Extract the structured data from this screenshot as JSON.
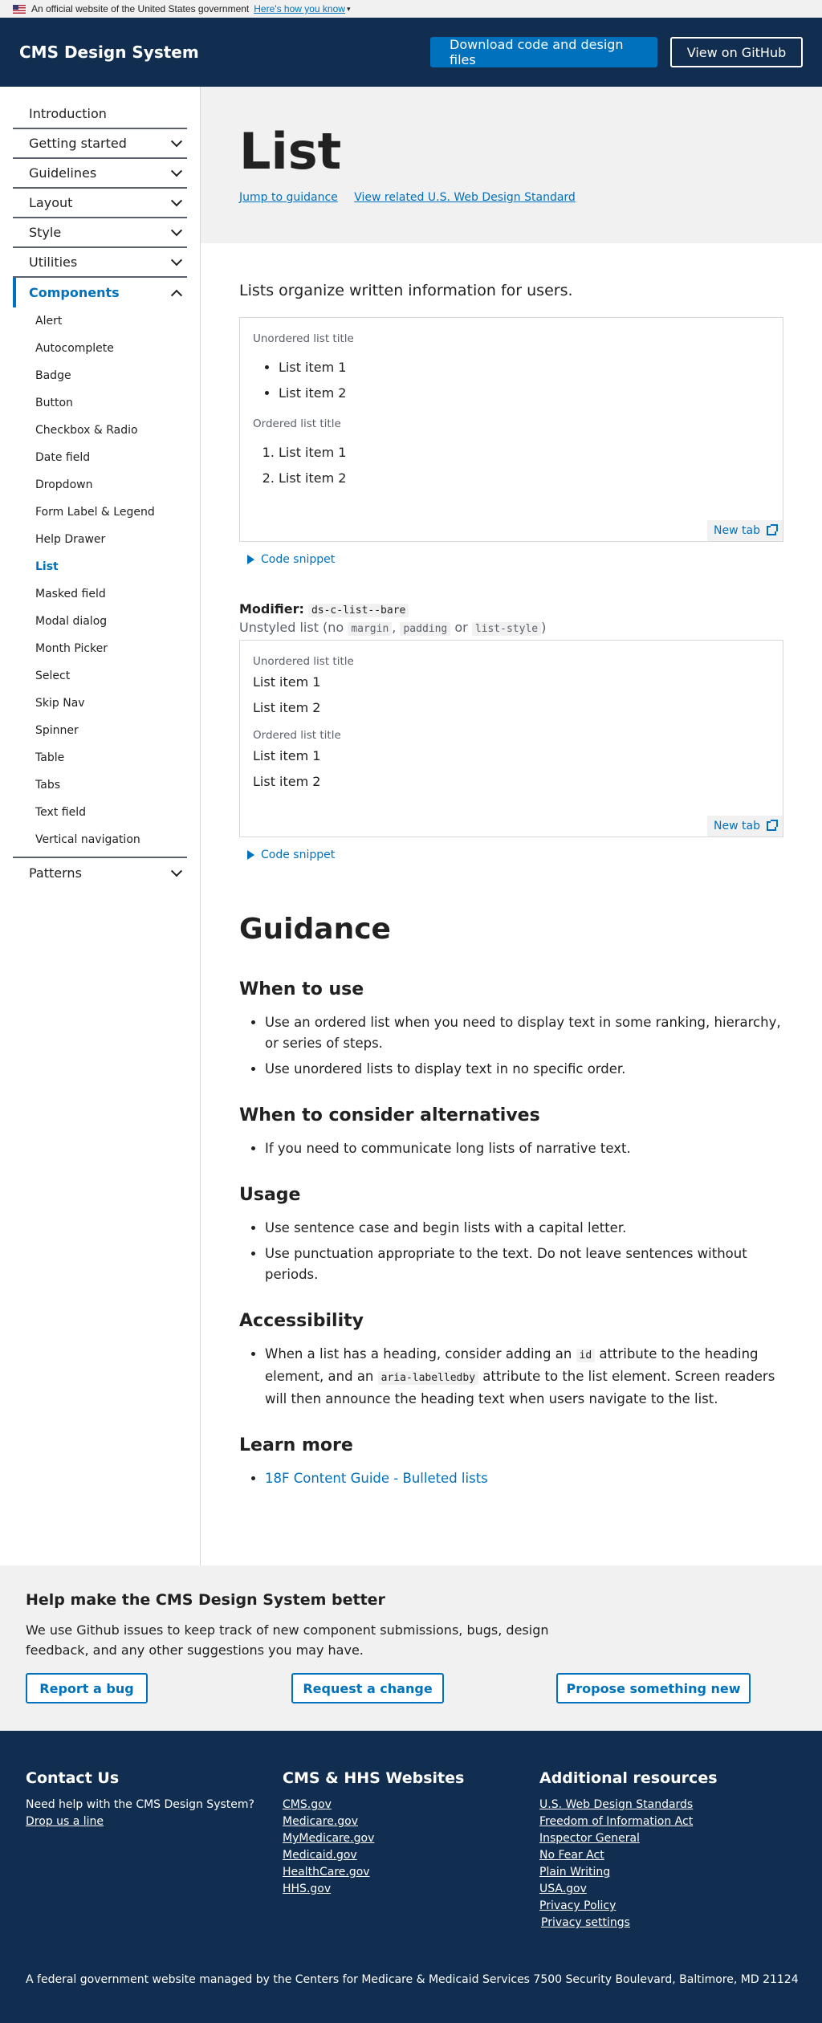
{
  "gov_banner": {
    "text": "An official website of the United States government",
    "link": "Here's how you know"
  },
  "header": {
    "title": "CMS Design System",
    "download_label": "Download code and design files",
    "github_label": "View on GitHub"
  },
  "sidebar": {
    "top_items": [
      "Introduction",
      "Getting started",
      "Guidelines",
      "Layout",
      "Style",
      "Utilities"
    ],
    "active_label": "Components",
    "sub_items": [
      "Alert",
      "Autocomplete",
      "Badge",
      "Button",
      "Checkbox & Radio",
      "Date field",
      "Dropdown",
      "Form Label & Legend",
      "Help Drawer",
      "List",
      "Masked field",
      "Modal dialog",
      "Month Picker",
      "Select",
      "Skip Nav",
      "Spinner",
      "Table",
      "Tabs",
      "Text field",
      "Vertical navigation"
    ],
    "current_sub": "List",
    "last_item": "Patterns"
  },
  "hero": {
    "title": "List",
    "link1": "Jump to guidance",
    "link2": "View related U.S. Web Design Standard"
  },
  "intro": "Lists organize written information for users.",
  "example1": {
    "ul_title": "Unordered list title",
    "ul_items": [
      "List item 1",
      "List item 2"
    ],
    "ol_title": "Ordered list title",
    "ol_items": [
      "List item 1",
      "List item 2"
    ],
    "newtab": "New tab",
    "snippet": "Code snippet"
  },
  "modifier": {
    "label": "Modifier:",
    "class": "ds-c-list--bare",
    "desc_prefix": "Unstyled list (no",
    "code1": "margin",
    "sep1": ",",
    "code2": "padding",
    "sep2": "or",
    "code3": "list-style",
    "desc_suffix": ")"
  },
  "example2": {
    "ul_title": "Unordered list title",
    "ul_items": [
      "List item 1",
      "List item 2"
    ],
    "ol_title": "Ordered list title",
    "ol_items": [
      "List item 1",
      "List item 2"
    ],
    "newtab": "New tab",
    "snippet": "Code snippet"
  },
  "guidance": {
    "title": "Guidance",
    "when_title": "When to use",
    "when_items": [
      "Use an ordered list when you need to display text in some ranking, hierarchy, or series of steps.",
      "Use unordered lists to display text in no specific order."
    ],
    "alt_title": "When to consider alternatives",
    "alt_items": [
      "If you need to communicate long lists of narrative text."
    ],
    "usage_title": "Usage",
    "usage_items": [
      "Use sentence case and begin lists with a capital letter.",
      "Use punctuation appropriate to the text. Do not leave sentences without periods."
    ],
    "a11y_title": "Accessibility",
    "a11y_p1": "When a list has a heading, consider adding an",
    "a11y_code1": "id",
    "a11y_p2": "attribute to the heading element, and an",
    "a11y_code2": "aria-labelledby",
    "a11y_p3": "attribute to the list element. Screen readers will then announce the heading text when users navigate to the list.",
    "learn_title": "Learn more",
    "learn_link": "18F Content Guide - Bulleted lists"
  },
  "feedback": {
    "title": "Help make the CMS Design System better",
    "body": "We use Github issues to keep track of new component submissions, bugs, design feedback, and any other suggestions you may have.",
    "btn_bug": "Report a bug",
    "btn_change": "Request a change",
    "btn_new": "Propose something new"
  },
  "footer": {
    "contact_title": "Contact Us",
    "contact_text": "Need help with the CMS Design System?",
    "contact_link": "Drop us a line",
    "websites_title": "CMS & HHS Websites",
    "websites": [
      "CMS.gov",
      "Medicare.gov",
      "MyMedicare.gov",
      "Medicaid.gov",
      "HealthCare.gov",
      "HHS.gov"
    ],
    "resources_title": "Additional resources",
    "resources": [
      "U.S. Web Design Standards",
      "Freedom of Information Act",
      "Inspector General",
      "No Fear Act",
      "Plain Writing",
      "USA.gov",
      "Privacy Policy",
      "Privacy settings"
    ],
    "bottom": "A federal government website managed by the Centers for Medicare & Medicaid Services 7500 Security Boulevard, Baltimore, MD 21124"
  },
  "colors": {
    "navy": "#112e51",
    "primary": "#0071bc",
    "gray_light": "#f1f1f1"
  }
}
